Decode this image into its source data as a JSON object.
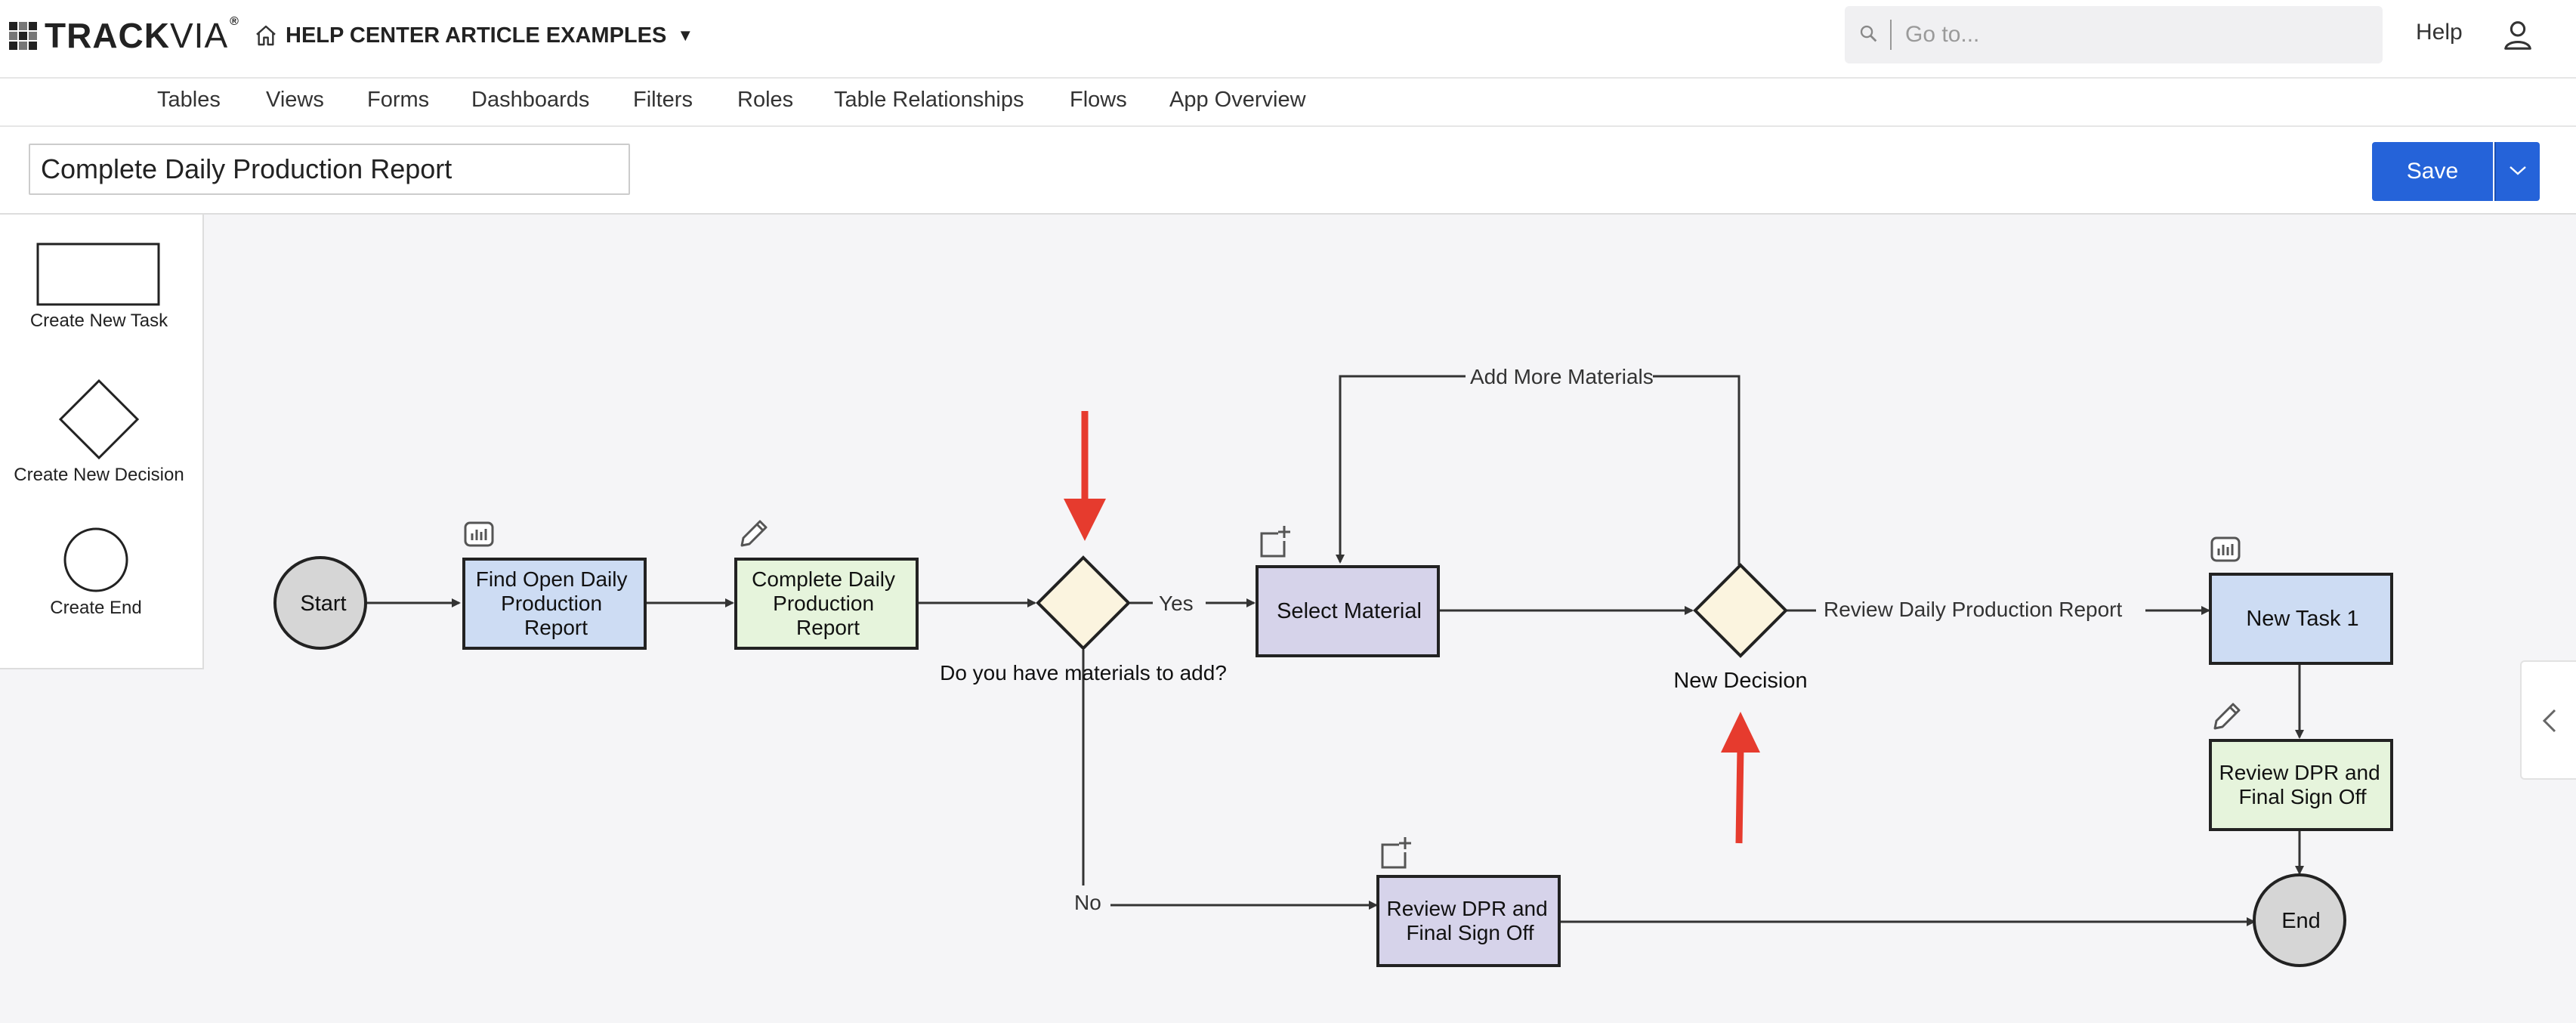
{
  "brand": {
    "name_bold": "TRACK",
    "name_thin": "VIA",
    "reg": "®"
  },
  "app": {
    "name": "HELP CENTER ARTICLE EXAMPLES",
    "caret": "▼"
  },
  "search": {
    "placeholder": "Go to..."
  },
  "header": {
    "help": "Help"
  },
  "nav": {
    "items": [
      "Tables",
      "Views",
      "Forms",
      "Dashboards",
      "Filters",
      "Roles",
      "Table Relationships",
      "Flows",
      "App Overview"
    ]
  },
  "flow": {
    "title": "Complete Daily Production Report",
    "save_label": "Save"
  },
  "palette": {
    "task": "Create New Task",
    "decision": "Create New Decision",
    "end": "Create End"
  },
  "nodes": {
    "start": "Start",
    "find_open": [
      "Find Open Daily",
      "Production",
      "Report"
    ],
    "complete_dpr": [
      "Complete Daily",
      "Production",
      "Report"
    ],
    "decision1": "Do you have materials to add?",
    "select_material": "Select Material",
    "decision2": "New Decision",
    "new_task1": "New Task 1",
    "review_right": [
      "Review DPR and",
      "Final Sign Off"
    ],
    "review_bottom": [
      "Review DPR and",
      "Final Sign Off"
    ],
    "end": "End"
  },
  "edges": {
    "yes": "Yes",
    "no": "No",
    "add_more": "Add More Materials",
    "review_dpr": "Review Daily Production Report"
  },
  "colors": {
    "accent": "#2563d9",
    "task_blue": "#cddcf3",
    "task_green": "#e6f4dc",
    "task_purple": "#d6d3ea",
    "decision_fill": "#fbf4df",
    "circle_fill": "#d6d6d6",
    "annotation_red": "#e63b2e"
  }
}
